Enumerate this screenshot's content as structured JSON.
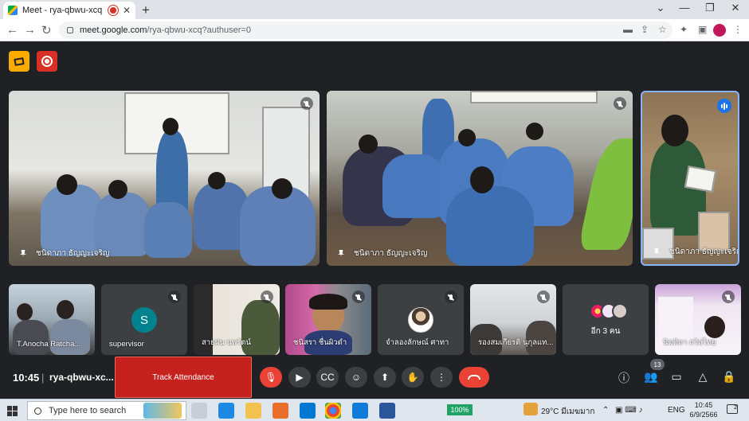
{
  "browser": {
    "tab_title": "Meet - rya-qbwu-xcq",
    "tab_close": "✕",
    "new_tab": "+",
    "window_controls": [
      "⌄",
      "—",
      "❐",
      "✕"
    ],
    "nav": {
      "back": "←",
      "forward": "→",
      "reload": "↻"
    },
    "url_host": "meet.google.com",
    "url_path": "/rya-qbwu-xcq?authuser=0",
    "toolbar_icons": [
      "camera-icon",
      "share-icon",
      "bookmark-star-icon",
      "extensions-icon",
      "sidepanel-icon",
      "profile-avatar",
      "menu-icon"
    ]
  },
  "meet": {
    "host_controls": [
      "closed-captions-off-icon",
      "record-icon"
    ],
    "main_tiles": [
      {
        "name": "ชนิดาภา ธัญญะเจริญ",
        "muted": true
      },
      {
        "name": "ชนิดาภา ธัญญะเจริญ",
        "muted": true
      },
      {
        "name": "ชนิดาภา ธัญญะเจริญ",
        "speaking": true
      }
    ],
    "small_tiles": [
      {
        "name": "T.Anocha Ratcha...",
        "type": "video"
      },
      {
        "name": "supervisor",
        "type": "avatar",
        "initial": "S",
        "muted": true
      },
      {
        "name": "สายฝน นพรัตน์",
        "type": "video",
        "muted": true
      },
      {
        "name": "ชนิสรา ชื่นผิวดำ",
        "type": "video",
        "muted": true
      },
      {
        "name": "จำลองลักษณ์ ศาทา",
        "type": "photo-avatar",
        "muted": true
      },
      {
        "name": "รองสมเกียรติ นุกุลแท...",
        "type": "video",
        "muted": true
      },
      {
        "name": "อีก 3 คน",
        "type": "more"
      },
      {
        "name": "นิตติดา ถวิลไทย",
        "type": "video",
        "muted": true
      }
    ],
    "bottom": {
      "time": "10:45",
      "separator": "|",
      "meeting_code": "rya-qbwu-xc...",
      "track_attendance": "Track Attendance",
      "people_count": "13"
    }
  },
  "taskbar": {
    "search_placeholder": "Type here to search",
    "battery_percent": "100%",
    "weather": "29°C มีเมฆมาก",
    "language": "ENG",
    "clock_time": "10:45",
    "clock_date": "6/9/2566",
    "notifications": "2"
  },
  "colors": {
    "meet_bg": "#202124",
    "tile_bg": "#3c4043",
    "leave_red": "#ea4335",
    "track_red": "#c5221f",
    "speaking_border": "#8ab4f8"
  }
}
